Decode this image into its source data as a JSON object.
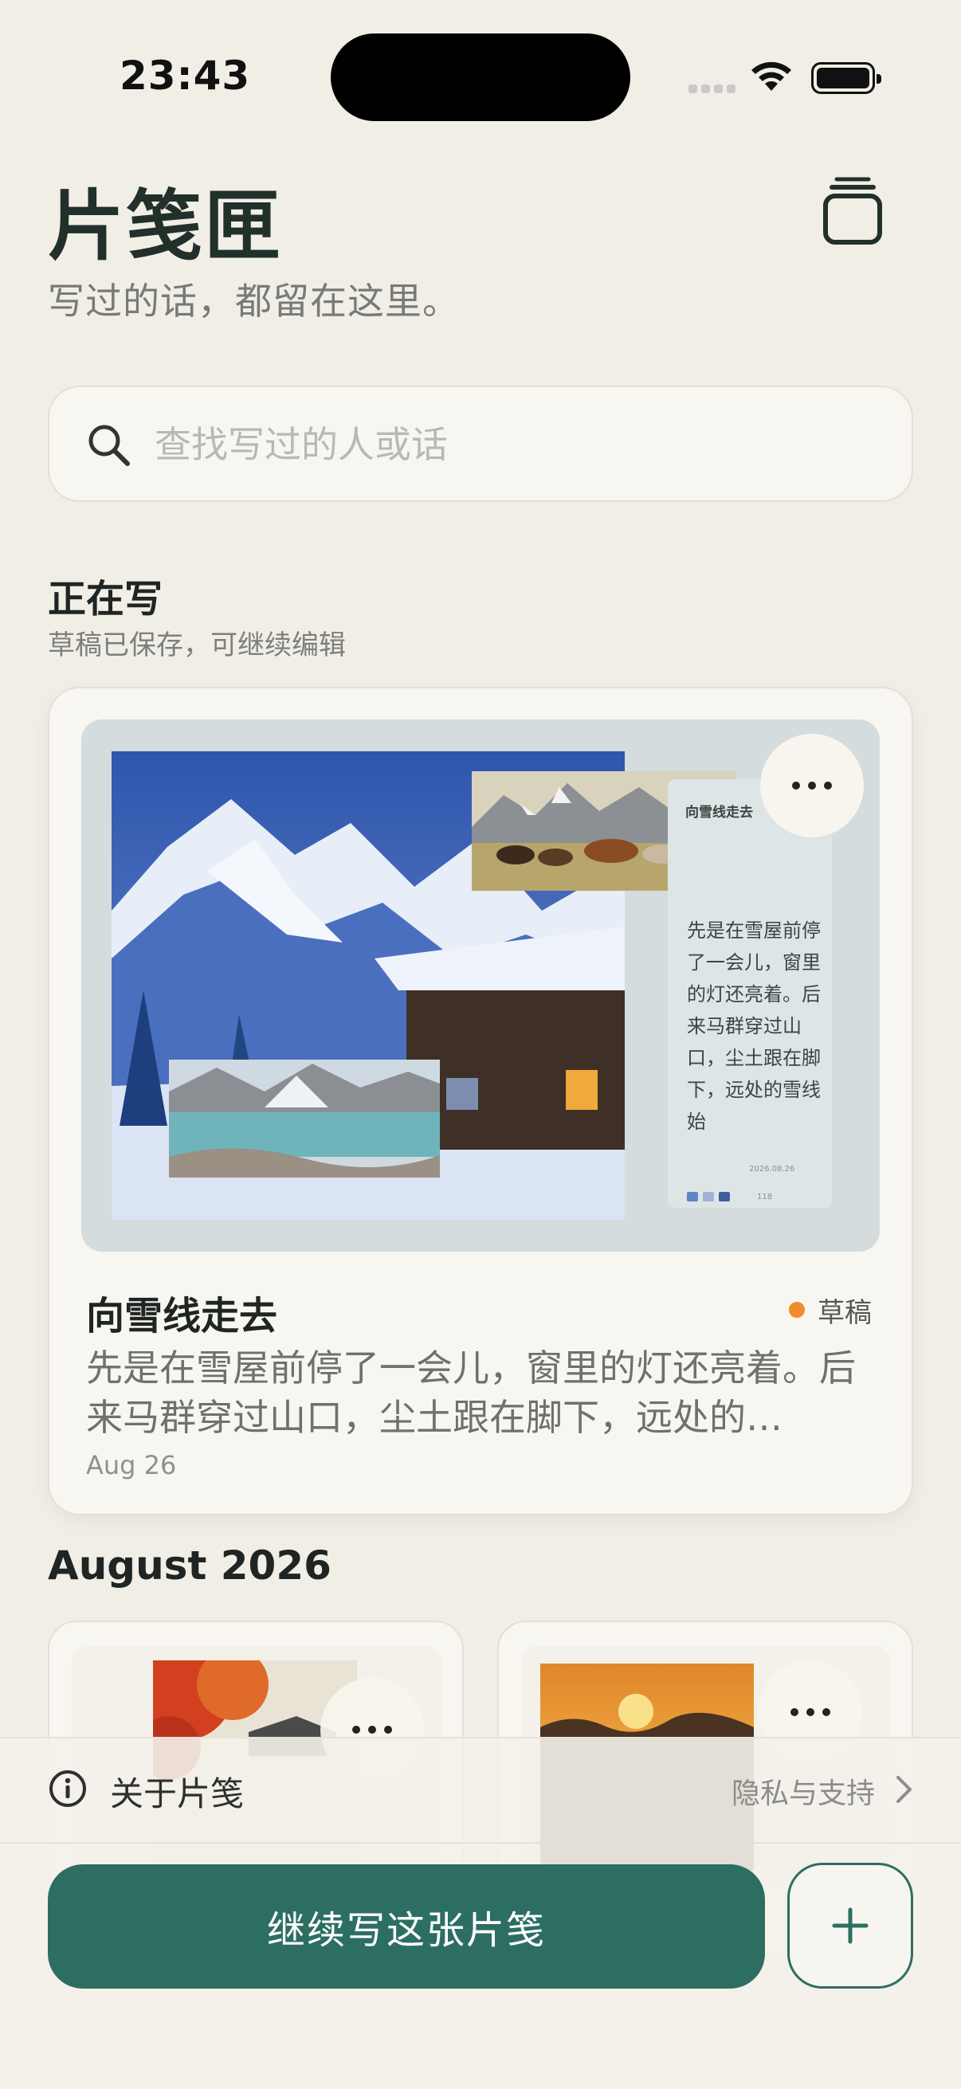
{
  "status_bar": {
    "time": "23:43"
  },
  "header": {
    "title": "片笺匣",
    "subtitle": "写过的话，都留在这里。"
  },
  "search": {
    "placeholder": "查找写过的人或话"
  },
  "drafts_section": {
    "title": "正在写",
    "subtitle": "草稿已保存，可继续编辑"
  },
  "draft_card": {
    "title": "向雪线走去",
    "status": "草稿",
    "excerpt": "先是在雪屋前停了一会儿，窗里的灯还亮着。后来马群穿过山口，尘土跟在脚下，远处的…",
    "date": "Aug 26",
    "preview": {
      "note_title": "向雪线走去",
      "note_text": "先是在雪屋前停了一会儿，窗里的灯还亮着。后来马群穿过山口，尘土跟在脚下，远处的雪线始",
      "note_date": "2026.08.26",
      "note_count": "118",
      "palette": [
        "#5f86c4",
        "#9fb3d8",
        "#3f5f9f"
      ]
    }
  },
  "month_section": {
    "title": "August 2026"
  },
  "footer": {
    "about_label": "关于片笺",
    "privacy_label": "隐私与支持"
  },
  "actions": {
    "continue_label": "继续写这张片笺"
  },
  "colors": {
    "background": "#f1eee6",
    "accent": "#2d6e63",
    "draft_dot": "#f08a2a"
  },
  "icons": [
    "search-icon",
    "stack-icon",
    "more-icon",
    "info-icon",
    "chevron-right-icon",
    "plus-icon"
  ]
}
